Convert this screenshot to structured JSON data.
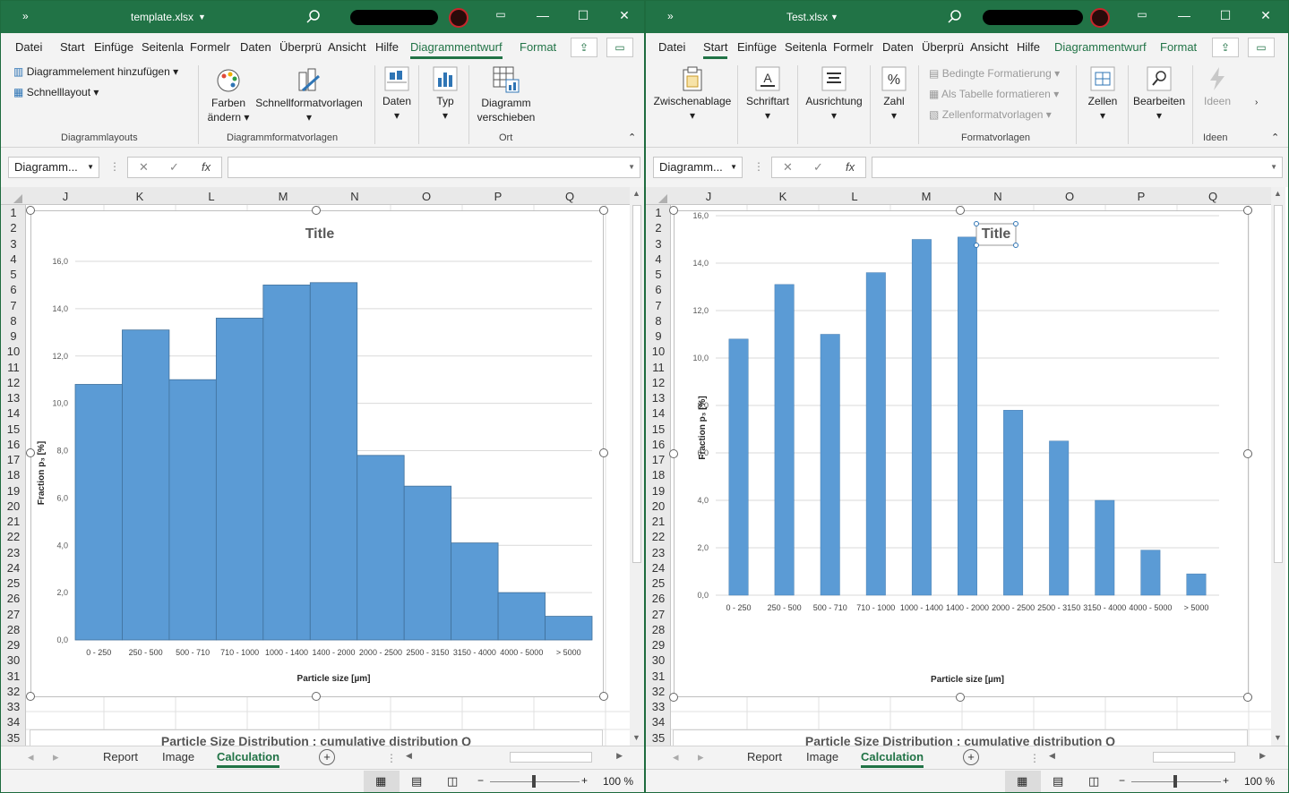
{
  "left": {
    "title": "template.xlsx",
    "tabs": [
      "Datei",
      "Start",
      "Einfüge",
      "Seitenla",
      "Formelr",
      "Daten",
      "Überprü",
      "Ansicht",
      "Hilfe",
      "Diagrammentwurf",
      "Format"
    ],
    "ribbon": {
      "add_element": "Diagrammelement hinzufügen",
      "quick_layout": "Schnelllayout",
      "colors_line1": "Farben",
      "colors_line2": "ändern",
      "quick_styles": "Schnellformatvorlagen",
      "data": "Daten",
      "type": "Typ",
      "move_line1": "Diagramm",
      "move_line2": "verschieben",
      "group_layouts": "Diagrammlayouts",
      "group_styles": "Diagrammformatvorlagen",
      "group_location": "Ort"
    },
    "namebox": "Diagramm...",
    "fx": "fx",
    "columns": [
      "J",
      "K",
      "L",
      "M",
      "N",
      "O",
      "P",
      "Q"
    ],
    "rows": [
      "1",
      "2",
      "3",
      "4",
      "5",
      "6",
      "7",
      "8",
      "9",
      "10",
      "11",
      "12",
      "13",
      "14",
      "15",
      "16",
      "17",
      "18",
      "19",
      "20",
      "21",
      "22",
      "23",
      "24",
      "25",
      "26",
      "27",
      "28",
      "29",
      "30",
      "31",
      "32",
      "33",
      "34",
      "35"
    ],
    "below_chart_text": "Particle Size Distribution : cumulative distribution Q",
    "sheets": [
      "Report",
      "Image",
      "Calculation"
    ],
    "zoom": "100 %"
  },
  "right": {
    "title": "Test.xlsx",
    "tabs": [
      "Datei",
      "Start",
      "Einfüge",
      "Seitenla",
      "Formelr",
      "Daten",
      "Überprü",
      "Ansicht",
      "Hilfe",
      "Diagrammentwurf",
      "Format"
    ],
    "ribbon": {
      "clipboard": "Zwischenablage",
      "font": "Schriftart",
      "alignment": "Ausrichtung",
      "number": "Zahl",
      "cond_format": "Bedingte Formatierung",
      "as_table": "Als Tabelle formatieren",
      "cell_styles": "Zellenformatvorlagen",
      "cells": "Zellen",
      "edit": "Bearbeiten",
      "ideas": "Ideen",
      "group_styles": "Formatvorlagen",
      "group_ideas": "Ideen"
    },
    "namebox": "Diagramm...",
    "fx": "fx",
    "columns": [
      "J",
      "K",
      "L",
      "M",
      "N",
      "O",
      "P",
      "Q"
    ],
    "rows": [
      "1",
      "2",
      "3",
      "4",
      "5",
      "6",
      "7",
      "8",
      "9",
      "10",
      "11",
      "12",
      "13",
      "14",
      "15",
      "16",
      "17",
      "18",
      "19",
      "20",
      "21",
      "22",
      "23",
      "24",
      "25",
      "26",
      "27",
      "28",
      "29",
      "30",
      "31",
      "32",
      "33",
      "34",
      "35"
    ],
    "below_chart_text": "Particle Size Distribution : cumulative distribution Q",
    "sheets": [
      "Report",
      "Image",
      "Calculation"
    ],
    "zoom": "100 %"
  },
  "chart_data": [
    {
      "type": "bar",
      "title": "Title",
      "xlabel": "Particle size [µm]",
      "ylabel": "Fraction p₃ [%]",
      "categories": [
        "0 - 250",
        "250 - 500",
        "500 - 710",
        "710 - 1000",
        "1000 - 1400",
        "1400 - 2000",
        "2000 - 2500",
        "2500 - 3150",
        "3150 - 4000",
        "4000 - 5000",
        "> 5000"
      ],
      "values": [
        10.8,
        13.1,
        11.0,
        13.6,
        15.0,
        15.1,
        7.8,
        6.5,
        4.1,
        2.0,
        1.0
      ],
      "ylim": [
        0,
        16
      ],
      "yticks": [
        "0,0",
        "2,0",
        "4,0",
        "6,0",
        "8,0",
        "10,0",
        "12,0",
        "14,0",
        "16,0"
      ],
      "gap": "none",
      "grid": true,
      "color": "#5b9bd5"
    },
    {
      "type": "bar",
      "title": "Title",
      "xlabel": "Particle size [µm]",
      "ylabel": "Fraction p₃ [%]",
      "categories": [
        "0 - 250",
        "250 - 500",
        "500 - 710",
        "710 - 1000",
        "1000 - 1400",
        "1400 - 2000",
        "2000 - 2500",
        "2500 - 3150",
        "3150 - 4000",
        "4000 - 5000",
        "> 5000"
      ],
      "values": [
        10.8,
        13.1,
        11.0,
        13.6,
        15.0,
        15.1,
        7.8,
        6.5,
        4.0,
        1.9,
        0.9
      ],
      "ylim": [
        0,
        16
      ],
      "yticks": [
        "0,0",
        "2,0",
        "4,0",
        "6,0",
        "8,0",
        "10,0",
        "12,0",
        "14,0",
        "16,0"
      ],
      "gap": "wide",
      "grid": true,
      "color": "#5b9bd5"
    }
  ]
}
